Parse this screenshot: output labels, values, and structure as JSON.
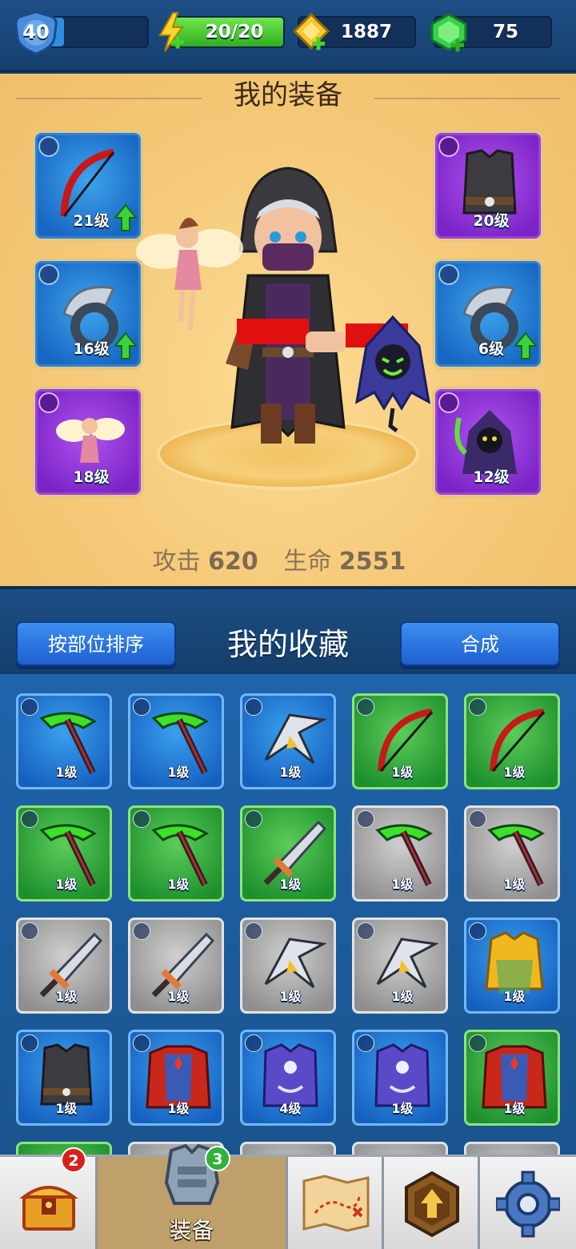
{
  "resources": {
    "level": "40",
    "xp_fraction": 0.15,
    "energy": "20/20",
    "energy_fraction": 1.0,
    "gold": "1887",
    "gems": "75"
  },
  "equipment": {
    "title": "我的装备",
    "slots": [
      {
        "name": "bow",
        "type": "weapon",
        "level": "21级",
        "upgradable": true,
        "rarity": "blue"
      },
      {
        "name": "ring",
        "type": "ring",
        "level": "16级",
        "upgradable": true,
        "rarity": "blue"
      },
      {
        "name": "fairy",
        "type": "pet",
        "level": "18级",
        "upgradable": false,
        "rarity": "purple"
      },
      {
        "name": "vest",
        "type": "armor",
        "level": "20级",
        "upgradable": false,
        "rarity": "purple"
      },
      {
        "name": "ring",
        "type": "ring",
        "level": "6级",
        "upgradable": true,
        "rarity": "blue"
      },
      {
        "name": "reaper",
        "type": "pet",
        "level": "12级",
        "upgradable": false,
        "rarity": "purple"
      }
    ],
    "stats": {
      "attack_label": "攻击",
      "attack": "620",
      "hp_label": "生命",
      "hp": "2551"
    }
  },
  "collection": {
    "title": "我的收藏",
    "sort_button": "按部位排序",
    "merge_button": "合成",
    "items": [
      {
        "icon": "scythe",
        "rarity": "blue",
        "level": "1级"
      },
      {
        "icon": "scythe",
        "rarity": "blue",
        "level": "1级"
      },
      {
        "icon": "boomerang",
        "rarity": "blue",
        "level": "1级"
      },
      {
        "icon": "bow",
        "rarity": "green",
        "level": "1级"
      },
      {
        "icon": "bow",
        "rarity": "green",
        "level": "1级"
      },
      {
        "icon": "scythe",
        "rarity": "green",
        "level": "1级"
      },
      {
        "icon": "scythe",
        "rarity": "green",
        "level": "1级"
      },
      {
        "icon": "sword",
        "rarity": "green",
        "level": "1级"
      },
      {
        "icon": "scythe",
        "rarity": "gray",
        "level": "1级"
      },
      {
        "icon": "scythe",
        "rarity": "gray",
        "level": "1级"
      },
      {
        "icon": "sword",
        "rarity": "gray",
        "level": "1级"
      },
      {
        "icon": "sword",
        "rarity": "gray",
        "level": "1级"
      },
      {
        "icon": "boomerang",
        "rarity": "gray",
        "level": "1级"
      },
      {
        "icon": "boomerang",
        "rarity": "gray",
        "level": "1级"
      },
      {
        "icon": "gold-armor",
        "rarity": "blue",
        "level": "1级"
      },
      {
        "icon": "vest",
        "rarity": "blue",
        "level": "1级"
      },
      {
        "icon": "red-armor",
        "rarity": "blue",
        "level": "1级"
      },
      {
        "icon": "purple-armor",
        "rarity": "blue",
        "level": "4级"
      },
      {
        "icon": "purple-armor",
        "rarity": "blue",
        "level": "1级"
      },
      {
        "icon": "red-armor",
        "rarity": "green",
        "level": "1级"
      }
    ]
  },
  "nav": {
    "shop_badge": "2",
    "equip_label": "装备",
    "equip_badge": "3"
  },
  "colors": {
    "accent_blue": "#1f5fd0",
    "rarity_blue": "#1766c2",
    "rarity_green": "#1d8f2d",
    "rarity_gray": "#8f8f8f",
    "rarity_purple": "#7a24c6"
  }
}
